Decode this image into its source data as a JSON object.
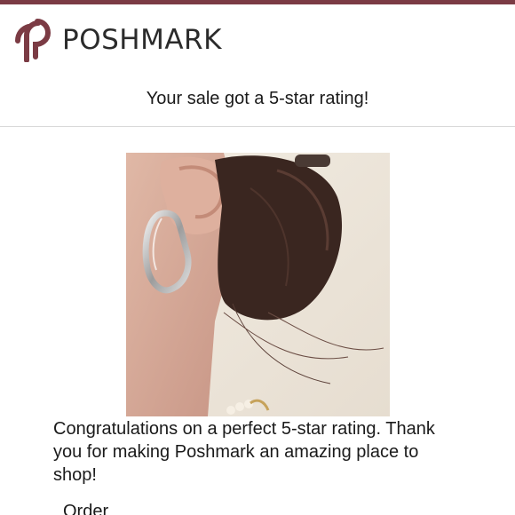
{
  "brand": {
    "name": "POSHMARK",
    "accent": "#7b3b44"
  },
  "email": {
    "subject": "Your sale got a 5-star rating!",
    "message": "Congratulations on a perfect 5-star rating. Thank you for making Poshmark an amazing place to shop!",
    "order_label": "Order"
  },
  "product_image": {
    "icon": "product-photo-earring"
  }
}
